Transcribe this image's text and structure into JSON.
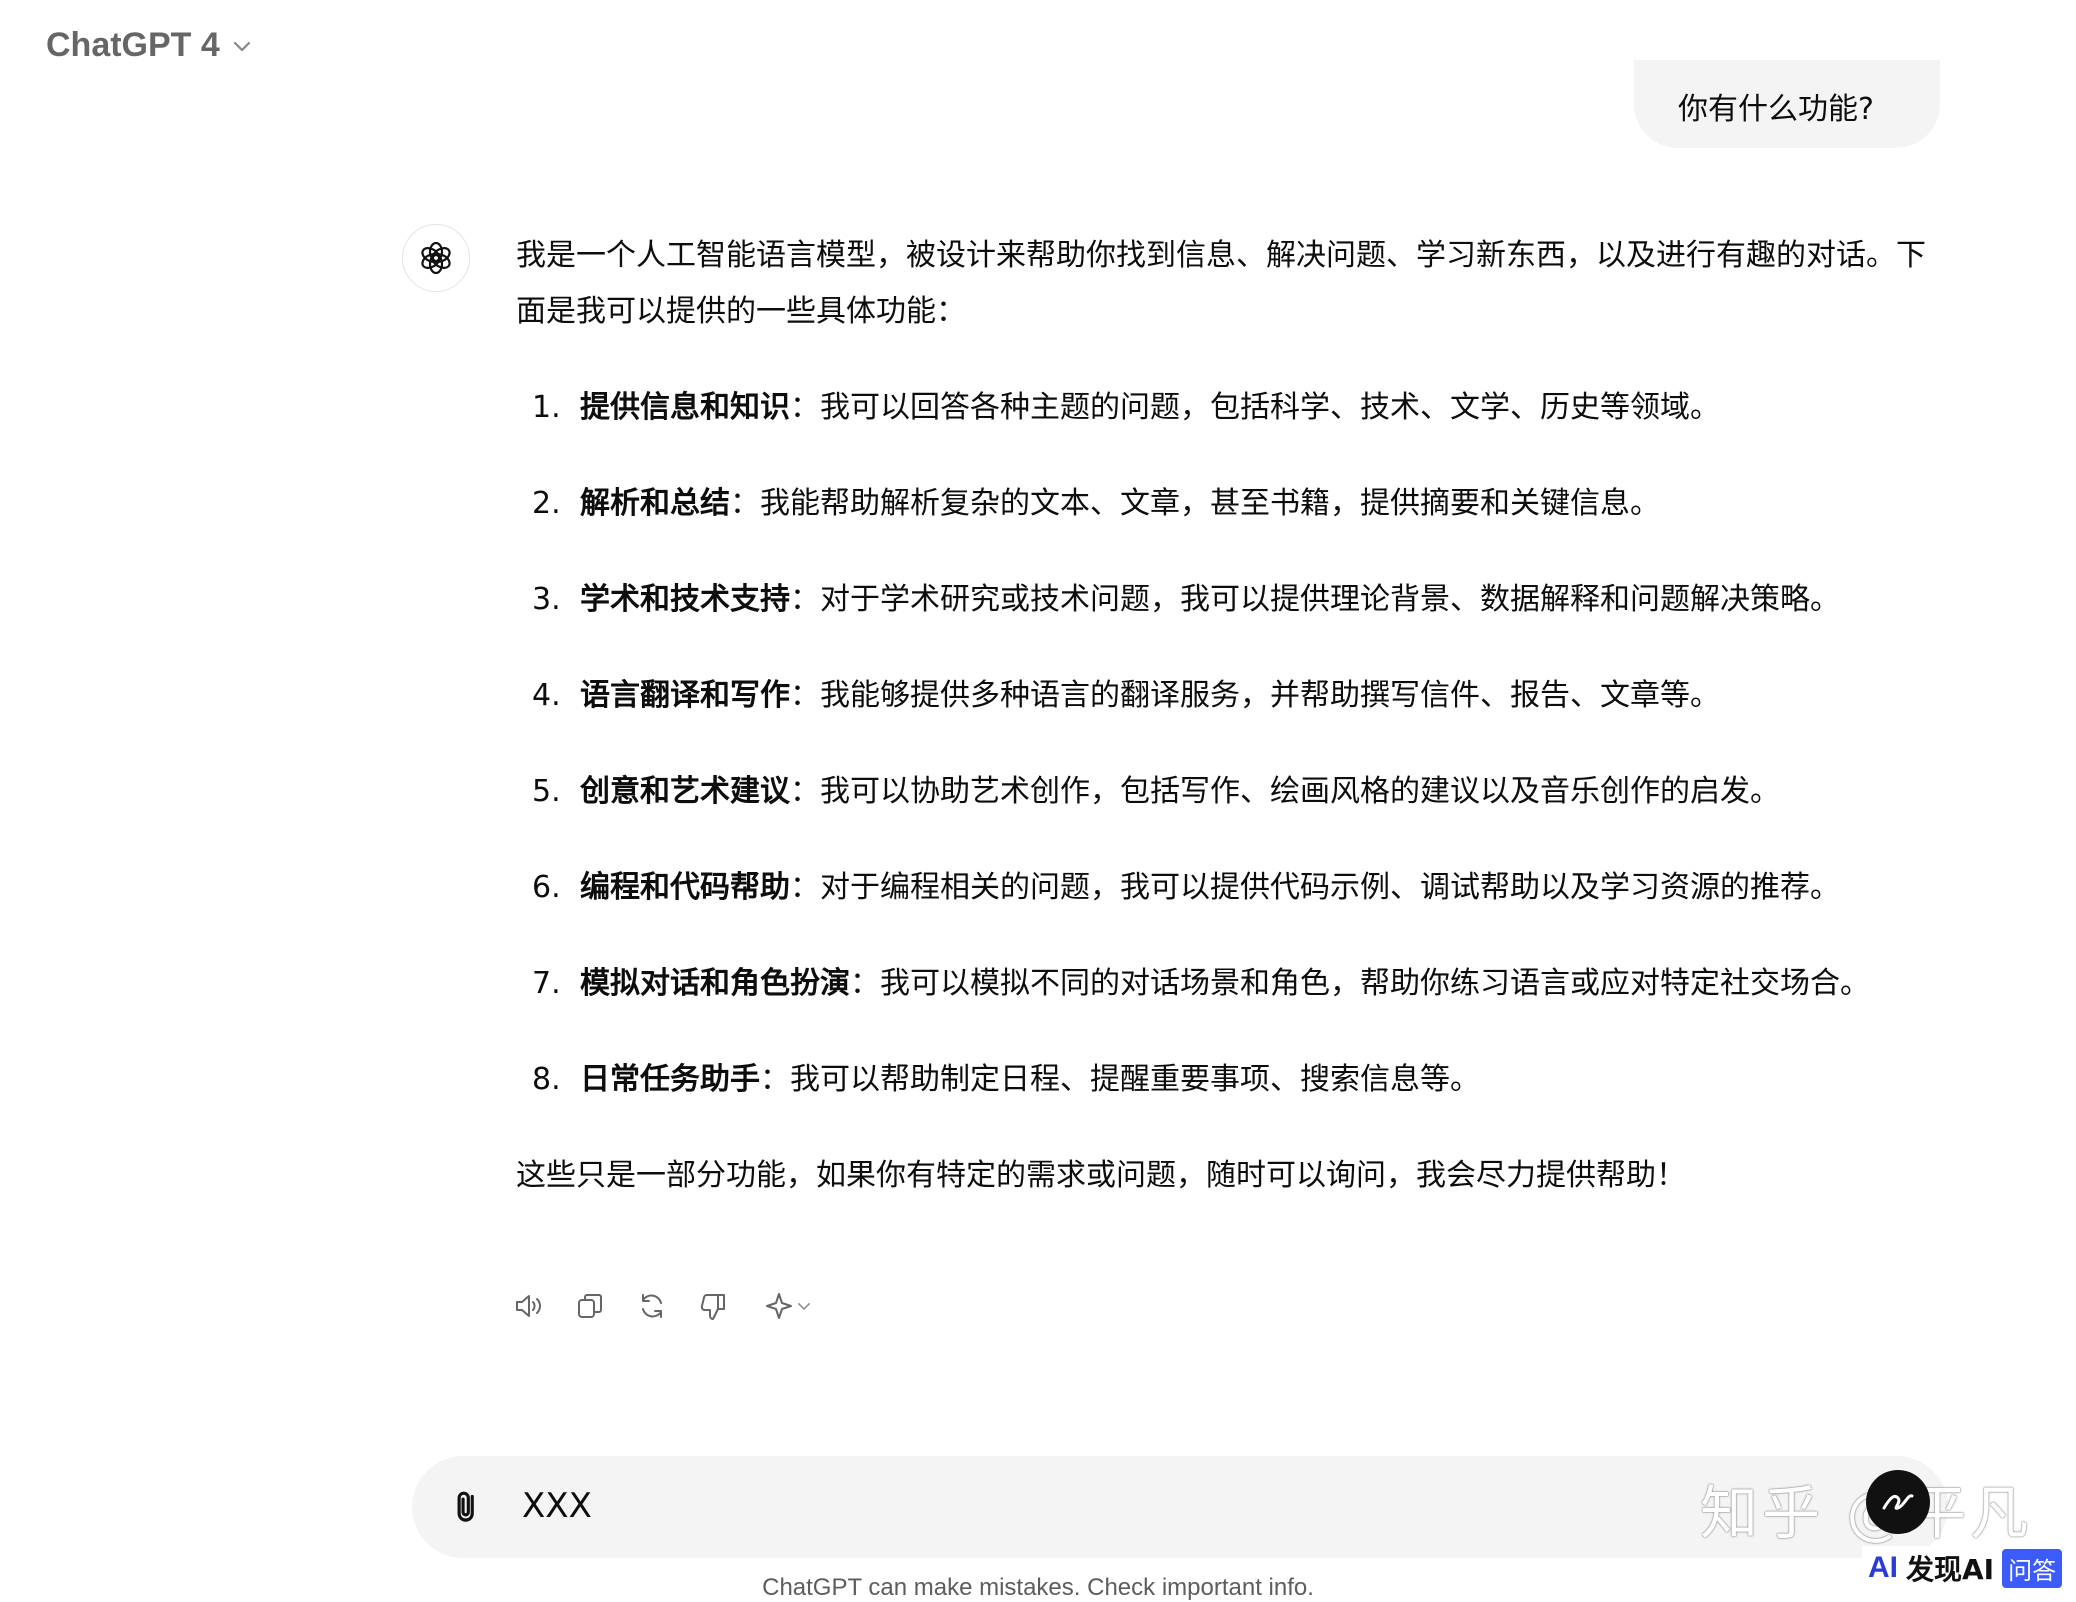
{
  "header": {
    "model_label": "ChatGPT 4"
  },
  "user_message": "你有什么功能?",
  "assistant": {
    "intro": "我是一个人工智能语言模型，被设计来帮助你找到信息、解决问题、学习新东西，以及进行有趣的对话。下面是我可以提供的一些具体功能：",
    "items": [
      {
        "num": "1.",
        "title": "提供信息和知识",
        "text": "：我可以回答各种主题的问题，包括科学、技术、文学、历史等领域。"
      },
      {
        "num": "2.",
        "title": "解析和总结",
        "text": "：我能帮助解析复杂的文本、文章，甚至书籍，提供摘要和关键信息。"
      },
      {
        "num": "3.",
        "title": "学术和技术支持",
        "text": "：对于学术研究或技术问题，我可以提供理论背景、数据解释和问题解决策略。"
      },
      {
        "num": "4.",
        "title": "语言翻译和写作",
        "text": "：我能够提供多种语言的翻译服务，并帮助撰写信件、报告、文章等。"
      },
      {
        "num": "5.",
        "title": "创意和艺术建议",
        "text": "：我可以协助艺术创作，包括写作、绘画风格的建议以及音乐创作的启发。"
      },
      {
        "num": "6.",
        "title": "编程和代码帮助",
        "text": "：对于编程相关的问题，我可以提供代码示例、调试帮助以及学习资源的推荐。"
      },
      {
        "num": "7.",
        "title": "模拟对话和角色扮演",
        "text": "：我可以模拟不同的对话场景和角色，帮助你练习语言或应对特定社交场合。"
      },
      {
        "num": "8.",
        "title": "日常任务助手",
        "text": "：我可以帮助制定日程、提醒重要事项、搜索信息等。"
      }
    ],
    "outro": "这些只是一部分功能，如果你有特定的需求或问题，随时可以询问，我会尽力提供帮助！"
  },
  "actions": {
    "icons": [
      "read-aloud-icon",
      "copy-icon",
      "regenerate-icon",
      "thumbs-down-icon",
      "sparkle-model-icon",
      "chevron-down-icon"
    ]
  },
  "composer": {
    "value": "XXX"
  },
  "footer_note": "ChatGPT can make mistakes. Check important info.",
  "watermark": {
    "zhihu": "知乎 @平凡",
    "badge_ai": "AI",
    "badge_brand": "发现AI",
    "badge_qa": "问答"
  },
  "colors": {
    "bubble": "#f4f4f4",
    "text": "#0d0d0d",
    "muted": "#666666"
  }
}
